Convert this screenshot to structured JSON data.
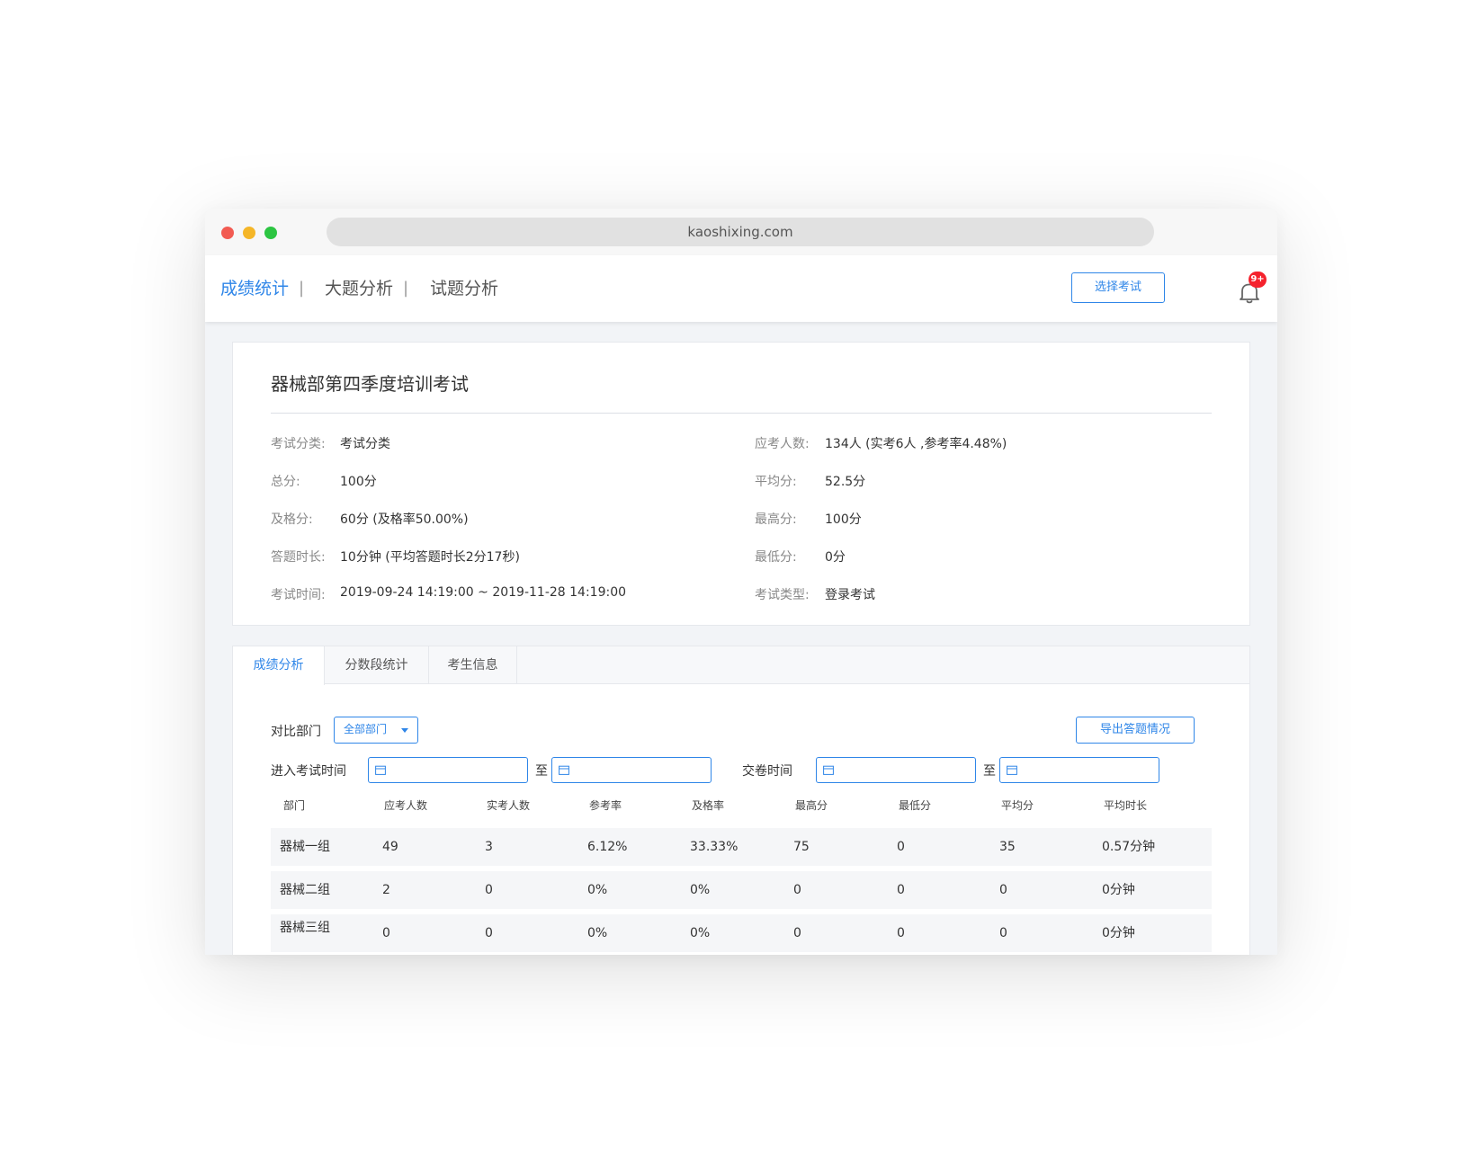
{
  "browser": {
    "url": "kaoshixing.com"
  },
  "nav": {
    "items": [
      {
        "label": "成绩统计",
        "active": true
      },
      {
        "label": "大题分析",
        "active": false
      },
      {
        "label": "试题分析",
        "active": false
      }
    ],
    "separator": "|",
    "select_exam": "选择考试",
    "badge": "9+"
  },
  "exam": {
    "title": "器械部第四季度培训考试",
    "left": [
      {
        "label": "考试分类:",
        "value": "考试分类"
      },
      {
        "label": "总分:",
        "value": "100分"
      },
      {
        "label": "及格分:",
        "value": "60分 (及格率50.00%)"
      },
      {
        "label": "答题时长:",
        "value": "10分钟 (平均答题时长2分17秒)"
      },
      {
        "label": "考试时间:",
        "value": "2019-09-24 14:19:00 ~ 2019-11-28 14:19:00"
      }
    ],
    "right": [
      {
        "label": "应考人数:",
        "value": "134人 (实考6人 ,参考率4.48%)"
      },
      {
        "label": "平均分:",
        "value": "52.5分"
      },
      {
        "label": "最高分:",
        "value": "100分"
      },
      {
        "label": "最低分:",
        "value": "0分"
      },
      {
        "label": "考试类型:",
        "value": "登录考试"
      }
    ]
  },
  "tabs": [
    "成绩分析",
    "分数段统计",
    "考生信息"
  ],
  "filters": {
    "compare_label": "对比部门",
    "dept_select": "全部部门",
    "export": "导出答题情况",
    "enter_time": "进入考试时间",
    "submit_time": "交卷时间",
    "to": "至"
  },
  "table": {
    "headers": [
      "部门",
      "应考人数",
      "实考人数",
      "参考率",
      "及格率",
      "最高分",
      "最低分",
      "平均分",
      "平均时长"
    ],
    "rows": [
      [
        "器械一组",
        "49",
        "3",
        "6.12%",
        "33.33%",
        "75",
        "0",
        "35",
        "0.57分钟"
      ],
      [
        "器械二组",
        "2",
        "0",
        "0%",
        "0%",
        "0",
        "0",
        "0",
        "0分钟"
      ],
      [
        "器械三组",
        "0",
        "0",
        "0%",
        "0%",
        "0",
        "0",
        "0",
        "0分钟"
      ]
    ]
  },
  "colors": {
    "accent": "#2f86e8",
    "badge": "#f5222d"
  },
  "icons": [
    "bell-icon",
    "calendar-icon",
    "chevron-down-icon"
  ]
}
